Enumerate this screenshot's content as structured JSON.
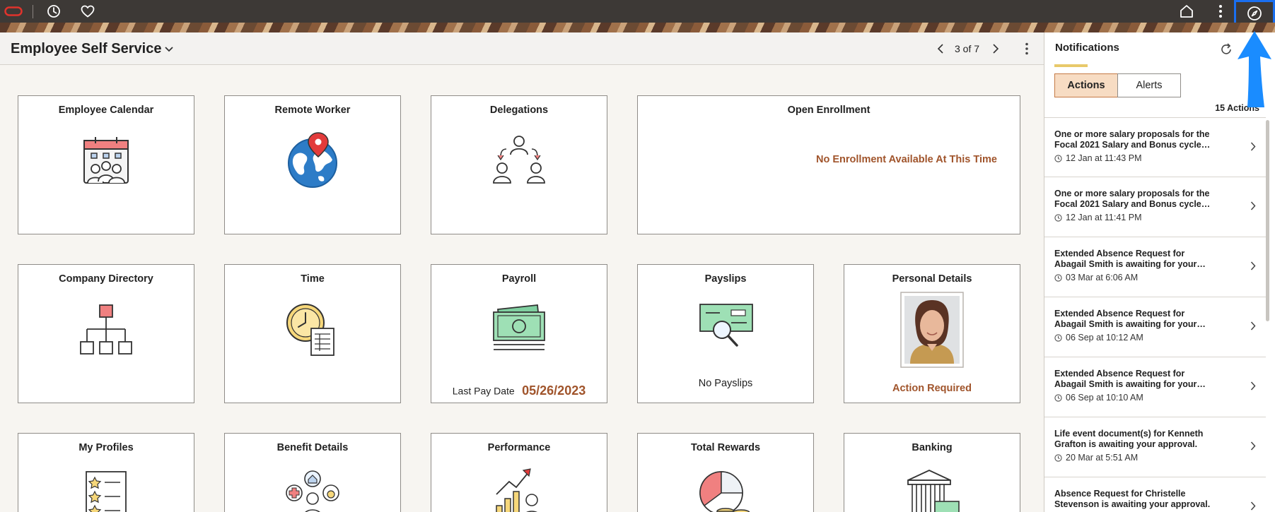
{
  "topbar": {
    "icons": [
      "oracle-logo-icon",
      "history-icon",
      "favorites-heart-icon",
      "home-icon",
      "vertical-dots-icon",
      "compass-navbar-icon"
    ],
    "highlight_color": "#1a6ff0"
  },
  "header": {
    "title": "Employee Self Service",
    "pager_text": "3 of 7"
  },
  "tiles": {
    "employee_calendar": {
      "title": "Employee Calendar"
    },
    "remote_worker": {
      "title": "Remote Worker"
    },
    "delegations": {
      "title": "Delegations"
    },
    "open_enrollment": {
      "title": "Open Enrollment",
      "message": "No Enrollment Available At This Time"
    },
    "company_directory": {
      "title": "Company Directory"
    },
    "time": {
      "title": "Time"
    },
    "payroll": {
      "title": "Payroll",
      "last_pay_label": "Last Pay Date",
      "last_pay_date": "05/26/2023"
    },
    "payslips": {
      "title": "Payslips",
      "message": "No Payslips"
    },
    "personal_details": {
      "title": "Personal Details",
      "status": "Action Required"
    },
    "my_profiles": {
      "title": "My Profiles"
    },
    "benefit_details": {
      "title": "Benefit Details"
    },
    "performance": {
      "title": "Performance"
    },
    "total_rewards": {
      "title": "Total Rewards"
    },
    "banking": {
      "title": "Banking"
    }
  },
  "notifications": {
    "title": "Notifications",
    "tabs": {
      "actions": "Actions",
      "alerts": "Alerts"
    },
    "count": "15 Actions",
    "items": [
      {
        "line1": "One or more salary proposals for the",
        "line2": "Focal 2021 Salary and Bonus cycle…",
        "time": "12 Jan at 11:43 PM"
      },
      {
        "line1": "One or more salary proposals for the",
        "line2": "Focal 2021 Salary and Bonus cycle…",
        "time": "12 Jan at 11:41 PM"
      },
      {
        "line1": "Extended Absence Request for",
        "line2": "Abagail Smith is awaiting for your…",
        "time": "03 Mar at 6:06 AM"
      },
      {
        "line1": "Extended Absence Request for",
        "line2": "Abagail Smith is awaiting for your…",
        "time": "06 Sep at 10:12 AM"
      },
      {
        "line1": "Extended Absence Request for",
        "line2": "Abagail Smith is awaiting for your…",
        "time": "06 Sep at 10:10 AM"
      },
      {
        "line1": "Life event document(s) for Kenneth",
        "line2": "Grafton is awaiting your approval.",
        "time": "20 Mar at 5:51 AM"
      },
      {
        "line1": "Absence Request for Christelle",
        "line2": "Stevenson is awaiting your approval.",
        "time": ""
      }
    ]
  },
  "colors": {
    "accent_warn": "#a0542b",
    "actions_tab_bg": "#f7dcc3",
    "topbar_bg": "#3d3936"
  }
}
